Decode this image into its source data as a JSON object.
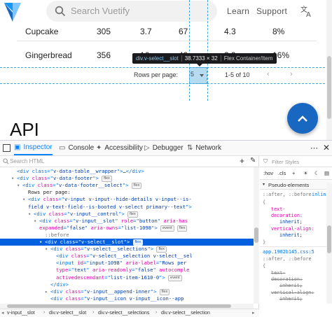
{
  "page": {
    "search_placeholder": "Search Vuetify",
    "nav": {
      "learn": "Learn",
      "support": "Support"
    },
    "table_rows": [
      {
        "name": "Cupcake",
        "calories": "305",
        "fat": "3.7",
        "carbs": "67",
        "protein": "4.3",
        "iron": "8%"
      },
      {
        "name": "Gingerbread",
        "calories": "356",
        "fat": "16",
        "carbs": "49",
        "protein": "3.9",
        "iron": "16%"
      }
    ],
    "footer": {
      "rows_per_page_label": "Rows per page:",
      "rows_per_page_value": "5",
      "range": "1-5 of 10",
      "prev": "‹",
      "next": "›"
    },
    "api_heading": "API"
  },
  "highlighter": {
    "selector": "div.v-select__slot",
    "dimensions": "38.7333 × 32",
    "layout": "Flex Container/Item"
  },
  "devtools": {
    "tabs": [
      {
        "label": "Inspector",
        "icon": "inspector-icon",
        "active": true
      },
      {
        "label": "Console",
        "icon": "console-icon",
        "active": false
      },
      {
        "label": "Accessibility",
        "icon": "accessibility-icon",
        "active": false
      },
      {
        "label": "Debugger",
        "icon": "debugger-icon",
        "active": false
      },
      {
        "label": "Network",
        "icon": "network-icon",
        "active": false
      }
    ],
    "search_placeholder": "Search HTML",
    "markup_lines": [
      {
        "indent": 2,
        "twisty": "",
        "html": "<span class=\"tag\">&lt;div class=\"</span><span class=\"val\">v-data-table__wrapper</span><span class=\"tag\">\"&gt;</span><span class=\"txt\">…</span><span class=\"tag\">&lt;/div&gt;</span>"
      },
      {
        "indent": 2,
        "twisty": "▾",
        "html": "<span class=\"tag\">&lt;div </span><span class=\"attr\">class</span><span class=\"tag\">=\"</span><span class=\"val\">v-data-footer</span><span class=\"tag\">\"&gt;</span> <span class=\"badge\">flex</span>"
      },
      {
        "indent": 3,
        "twisty": "▾",
        "html": "<span class=\"tag\">&lt;div </span><span class=\"attr\">class</span><span class=\"tag\">=\"</span><span class=\"val\">v-data-footer__select</span><span class=\"tag\">\"&gt;</span> <span class=\"badge\">flex</span>"
      },
      {
        "indent": 4,
        "twisty": "",
        "html": "<span class=\"txt\">Rows per page:</span>"
      },
      {
        "indent": 4,
        "twisty": "▾",
        "html": "<span class=\"tag\">&lt;div </span><span class=\"attr\">class</span><span class=\"tag\">=\"</span><span class=\"val\">v-input v-input--hide-details v-input--is-</span>"
      },
      {
        "indent": 4,
        "twisty": "",
        "html": "<span class=\"val\">field v-text-field--is-booted v-select primary--text</span><span class=\"tag\">\"&gt;</span>"
      },
      {
        "indent": 5,
        "twisty": "▾",
        "html": "<span class=\"tag\">&lt;div </span><span class=\"attr\">class</span><span class=\"tag\">=\"</span><span class=\"val\">v-input__control</span><span class=\"tag\">\"&gt;</span> <span class=\"badge\">flex</span>"
      },
      {
        "indent": 6,
        "twisty": "▾",
        "html": "<span class=\"tag\">&lt;div </span><span class=\"attr\">class</span><span class=\"tag\">=\"</span><span class=\"val\">v-input__slot</span><span class=\"tag\">\" </span><span class=\"attr\">role</span><span class=\"tag\">=\"</span><span class=\"val\">button</span><span class=\"tag\">\" </span><span class=\"attr\">aria-has</span>"
      },
      {
        "indent": 6,
        "twisty": "",
        "html": "<span class=\"attr\">expanded</span><span class=\"tag\">=\"</span><span class=\"val\">false</span><span class=\"tag\">\" </span><span class=\"attr\">aria-owns</span><span class=\"tag\">=\"</span><span class=\"val\">list-1098</span><span class=\"tag\">\"&gt;</span> <span class=\"badge\">event</span> <span class=\"badge\">flex</span>"
      },
      {
        "indent": 7,
        "twisty": "",
        "html": "<span class=\"pseudo\">::before</span>"
      },
      {
        "indent": 7,
        "twisty": "▾",
        "html": "<span class=\"tag\">&lt;div </span><span class=\"attr\">class</span><span class=\"tag\">=\"</span><span class=\"val\">v-select__slot</span><span class=\"tag\">\"&gt;</span> <span class=\"badge\">flex</span>",
        "selected": true
      },
      {
        "indent": 8,
        "twisty": "▾",
        "html": "<span class=\"tag\">&lt;div </span><span class=\"attr\">class</span><span class=\"tag\">=\"</span><span class=\"val\">v-select__selections</span><span class=\"tag\">\"&gt;</span> <span class=\"badge\">flex</span>"
      },
      {
        "indent": 9,
        "twisty": "",
        "html": "<span class=\"tag\">&lt;div </span><span class=\"attr\">class</span><span class=\"tag\">=\"</span><span class=\"val\">v-select__selection v-select__sel</span>"
      },
      {
        "indent": 9,
        "twisty": "",
        "html": "<span class=\"tag\">&lt;input </span><span class=\"attr\">id</span><span class=\"tag\">=\"</span><span class=\"val\">input-1098</span><span class=\"tag\">\" </span><span class=\"attr\">aria-label</span><span class=\"tag\">=\"</span><span class=\"val\">Rows per</span>"
      },
      {
        "indent": 9,
        "twisty": "",
        "html": "<span class=\"attr\">type</span><span class=\"tag\">=\"</span><span class=\"val\">text</span><span class=\"tag\">\" </span><span class=\"attr\">aria-readonly</span><span class=\"tag\">=\"</span><span class=\"val\">false</span><span class=\"tag\">\" </span><span class=\"attr\">autocomple</span>"
      },
      {
        "indent": 9,
        "twisty": "",
        "html": "<span class=\"attr\">activedescendant</span><span class=\"tag\">=\"</span><span class=\"val\">list-item-1610-0</span><span class=\"tag\">\"&gt;</span> <span class=\"badge\">event</span>"
      },
      {
        "indent": 8,
        "twisty": "",
        "html": "<span class=\"tag\">&lt;/div&gt;</span>"
      },
      {
        "indent": 8,
        "twisty": "▸",
        "html": "<span class=\"tag\">&lt;div </span><span class=\"attr\">class</span><span class=\"tag\">=\"</span><span class=\"val\">v-input__append-inner</span><span class=\"tag\">\"&gt;</span> <span class=\"badge\">flex</span>"
      },
      {
        "indent": 8,
        "twisty": "",
        "html": "<span class=\"tag\">&lt;div </span><span class=\"attr\">class</span><span class=\"tag\">=\"</span><span class=\"val\">v-input__icon v-input__icon--app</span>"
      }
    ],
    "breadcrumbs": [
      "v-input__slot",
      "div.v-select__slot",
      "div.v-select__selections",
      "div.v-select__selection"
    ],
    "rules": {
      "filter_placeholder": "Filter Styles",
      "toolbar": {
        "hov": ":hov",
        "cls": ".cls"
      },
      "pseudo_elements_label": "Pseudo-elements",
      "r1_selector": "::after, ::before",
      "r1_file": "inline:5",
      "r1_brace": "{",
      "r1_prop": "text-",
      "r1_prop2": "decoration:",
      "r1_val": "inherit;",
      "r1_prop3": "vertical-align:",
      "r1_val2": "inherit;",
      "r1_close": "}",
      "r2_source": "app.1902b145.css:5",
      "r2_selector": "::after, ::before",
      "r2_brace": "{",
      "r2_struck1": "text-",
      "r2_struck2": "decoration:",
      "r2_struck3": "inherit;",
      "r2_struck4": "vertical-align:",
      "r2_struck5": "inherit;"
    }
  },
  "colors": {
    "accent": "#1867c0",
    "devtools_accent": "#0a84ff",
    "selection": "#0060df",
    "highlight_fill": "#58b0dc"
  }
}
